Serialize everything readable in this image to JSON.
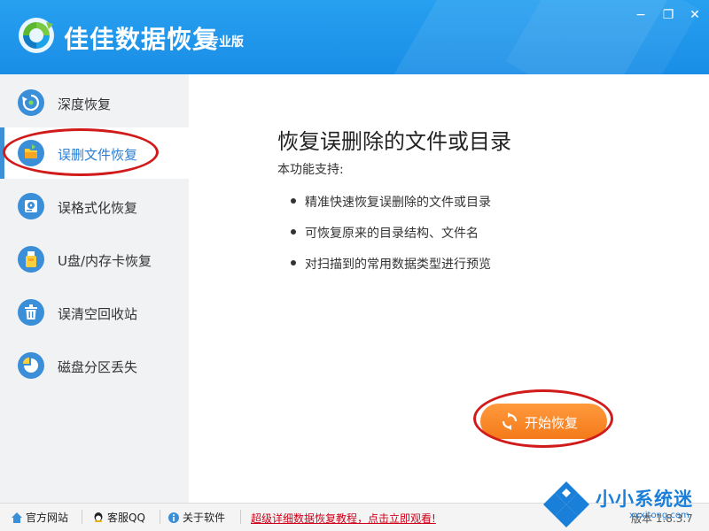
{
  "app": {
    "title": "佳佳数据恢复",
    "edition": "专业版"
  },
  "window_controls": {
    "minimize": "−",
    "maximize": "❐",
    "close": "✕"
  },
  "sidebar": {
    "items": [
      {
        "label": "深度恢复",
        "icon": "deep-recovery-icon",
        "active": false
      },
      {
        "label": "误删文件恢复",
        "icon": "folder-icon",
        "active": true
      },
      {
        "label": "误格式化恢复",
        "icon": "hard-disk-icon",
        "active": false
      },
      {
        "label": "U盘/内存卡恢复",
        "icon": "usb-drive-icon",
        "active": false
      },
      {
        "label": "误清空回收站",
        "icon": "recycle-bin-icon",
        "active": false
      },
      {
        "label": "磁盘分区丢失",
        "icon": "partition-pie-icon",
        "active": false
      }
    ]
  },
  "main": {
    "heading": "恢复误删除的文件或目录",
    "support_label": "本功能支持:",
    "features": [
      "精准快速恢复误删除的文件或目录",
      "可恢复原来的目录结构、文件名",
      "对扫描到的常用数据类型进行预览"
    ],
    "start_button": "开始恢复"
  },
  "footer": {
    "links": [
      {
        "label": "官方网站",
        "icon": "home-icon"
      },
      {
        "label": "客服QQ",
        "icon": "qq-icon"
      },
      {
        "label": "关于软件",
        "icon": "info-icon"
      }
    ],
    "promo": "超级详细数据恢复教程，点击立即观看!",
    "version": "版本 1.8.3.7"
  },
  "watermark": {
    "text": "小小系统迷",
    "sub": "xxxitong.com"
  },
  "colors": {
    "title_bar": "#1a8ee6",
    "accent": "#3a8fd8",
    "start_button": "#f47a1a",
    "promo": "#d0021b",
    "annotation_ring": "#d11a1a"
  }
}
